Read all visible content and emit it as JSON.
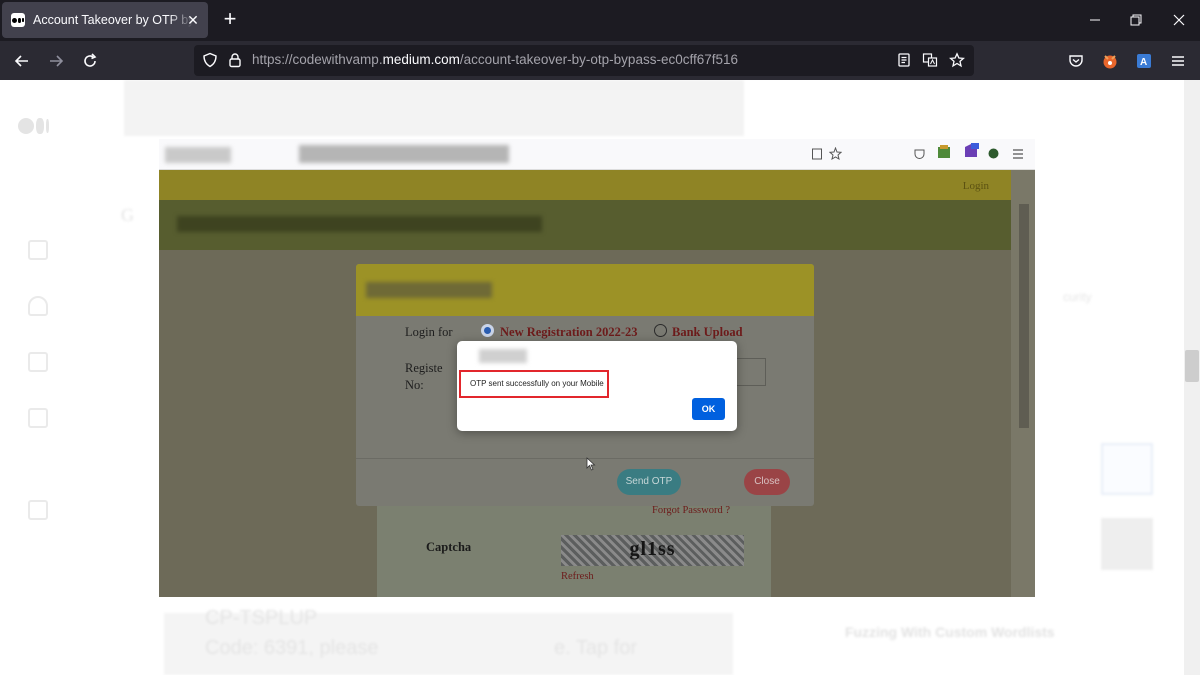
{
  "browser": {
    "tab_title": "Account Takeover by OTP bypass",
    "tab_close": "✕",
    "new_tab": "+",
    "url_prefix": "https://codewithvamp.",
    "url_domain": "medium.com",
    "url_path": "/account-takeover-by-otp-bypass-ec0cff67f516",
    "window_controls": [
      "—",
      "❐",
      "✕"
    ]
  },
  "embedded": {
    "header_link": "Login",
    "login_for_label": "Login for",
    "option_new_registration": "New Registration 2022-23",
    "option_bank_upload": "Bank Upload",
    "registration_label_line1": "Registe",
    "registration_label_line2": "No:",
    "send_otp_button": "Send OTP",
    "close_button": "Close",
    "forgot_password": "Forgot Password ?",
    "captcha_label": "Captcha",
    "captcha_text": "gl1ss",
    "refresh_link": "Refresh"
  },
  "alert": {
    "message": "OTP sent successfully on your Mobile",
    "ok_button": "OK"
  },
  "article": {
    "line1": "CP-TSPLUP",
    "line2": "Code: 6391, please",
    "line2_end": "e. Tap for",
    "sidebar_heading": "Fuzzing With Custom Wordlists",
    "sidebar_letter": "G",
    "sidebar_word": "curity"
  },
  "colors": {
    "browser_dark": "#1c1b22",
    "tab_active": "#42414d",
    "alert_ok": "#0060df",
    "highlight_red": "#e2262c"
  }
}
